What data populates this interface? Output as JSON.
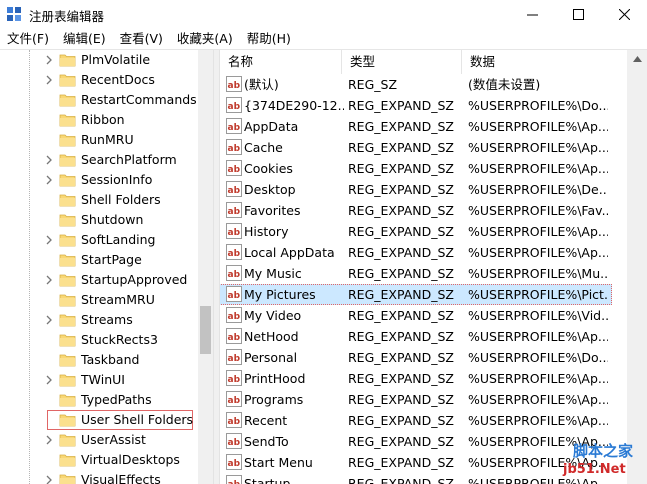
{
  "window": {
    "title": "注册表编辑器"
  },
  "menu": [
    {
      "label": "文件(F)"
    },
    {
      "label": "编辑(E)"
    },
    {
      "label": "查看(V)"
    },
    {
      "label": "收藏夹(A)"
    },
    {
      "label": "帮助(H)"
    }
  ],
  "tree": {
    "items": [
      {
        "label": "PlmVolatile",
        "expandable": true
      },
      {
        "label": "RecentDocs",
        "expandable": true
      },
      {
        "label": "RestartCommands",
        "expandable": false
      },
      {
        "label": "Ribbon",
        "expandable": false
      },
      {
        "label": "RunMRU",
        "expandable": false
      },
      {
        "label": "SearchPlatform",
        "expandable": true
      },
      {
        "label": "SessionInfo",
        "expandable": true
      },
      {
        "label": "Shell Folders",
        "expandable": false
      },
      {
        "label": "Shutdown",
        "expandable": false
      },
      {
        "label": "SoftLanding",
        "expandable": true
      },
      {
        "label": "StartPage",
        "expandable": false
      },
      {
        "label": "StartupApproved",
        "expandable": true
      },
      {
        "label": "StreamMRU",
        "expandable": false
      },
      {
        "label": "Streams",
        "expandable": true
      },
      {
        "label": "StuckRects3",
        "expandable": false
      },
      {
        "label": "Taskband",
        "expandable": false
      },
      {
        "label": "TWinUI",
        "expandable": true
      },
      {
        "label": "TypedPaths",
        "expandable": false
      },
      {
        "label": "User Shell Folders",
        "expandable": false,
        "selected": true
      },
      {
        "label": "UserAssist",
        "expandable": true
      },
      {
        "label": "VirtualDesktops",
        "expandable": false
      },
      {
        "label": "VisualEffects",
        "expandable": true
      }
    ]
  },
  "list": {
    "columns": {
      "name": "名称",
      "type": "类型",
      "data": "数据"
    },
    "rows": [
      {
        "name": "(默认)",
        "type": "REG_SZ",
        "data": "(数值未设置)"
      },
      {
        "name": "{374DE290-12...",
        "type": "REG_EXPAND_SZ",
        "data": "%USERPROFILE%\\Do..."
      },
      {
        "name": "AppData",
        "type": "REG_EXPAND_SZ",
        "data": "%USERPROFILE%\\Ap..."
      },
      {
        "name": "Cache",
        "type": "REG_EXPAND_SZ",
        "data": "%USERPROFILE%\\Ap..."
      },
      {
        "name": "Cookies",
        "type": "REG_EXPAND_SZ",
        "data": "%USERPROFILE%\\Ap..."
      },
      {
        "name": "Desktop",
        "type": "REG_EXPAND_SZ",
        "data": "%USERPROFILE%\\De..."
      },
      {
        "name": "Favorites",
        "type": "REG_EXPAND_SZ",
        "data": "%USERPROFILE%\\Fav..."
      },
      {
        "name": "History",
        "type": "REG_EXPAND_SZ",
        "data": "%USERPROFILE%\\Ap..."
      },
      {
        "name": "Local AppData",
        "type": "REG_EXPAND_SZ",
        "data": "%USERPROFILE%\\Ap..."
      },
      {
        "name": "My Music",
        "type": "REG_EXPAND_SZ",
        "data": "%USERPROFILE%\\Mu..."
      },
      {
        "name": "My Pictures",
        "type": "REG_EXPAND_SZ",
        "data": "%USERPROFILE%\\Pict...",
        "selected": true
      },
      {
        "name": "My Video",
        "type": "REG_EXPAND_SZ",
        "data": "%USERPROFILE%\\Vid..."
      },
      {
        "name": "NetHood",
        "type": "REG_EXPAND_SZ",
        "data": "%USERPROFILE%\\Ap..."
      },
      {
        "name": "Personal",
        "type": "REG_EXPAND_SZ",
        "data": "%USERPROFILE%\\Do..."
      },
      {
        "name": "PrintHood",
        "type": "REG_EXPAND_SZ",
        "data": "%USERPROFILE%\\Ap..."
      },
      {
        "name": "Programs",
        "type": "REG_EXPAND_SZ",
        "data": "%USERPROFILE%\\Ap..."
      },
      {
        "name": "Recent",
        "type": "REG_EXPAND_SZ",
        "data": "%USERPROFILE%\\Ap..."
      },
      {
        "name": "SendTo",
        "type": "REG_EXPAND_SZ",
        "data": "%USERPROFILE%\\Ap..."
      },
      {
        "name": "Start Menu",
        "type": "REG_EXPAND_SZ",
        "data": "%USERPROFILE%\\Ap..."
      },
      {
        "name": "Startup",
        "type": "REG_EXPAND_SZ",
        "data": "%USERPROFILE%\\Ap..."
      }
    ]
  },
  "watermark": {
    "cn": "脚本之家",
    "en": "jb51.Net"
  },
  "colors": {
    "selection": "#cce8ff",
    "highlight_box": "#e06666",
    "folder": "#f8d775"
  }
}
